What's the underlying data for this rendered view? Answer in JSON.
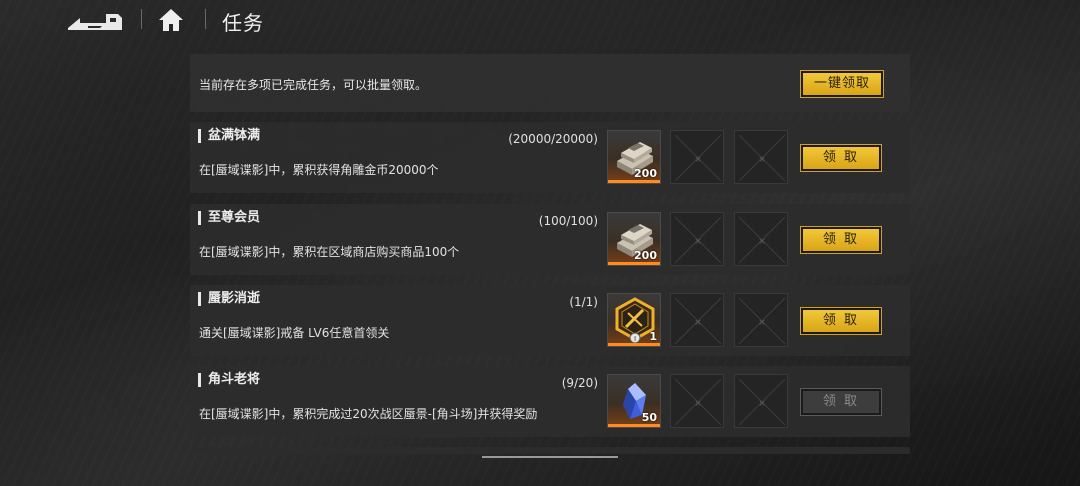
{
  "header": {
    "title": "任务",
    "back_icon": "back-arrow-icon",
    "home_icon": "home-icon"
  },
  "batch": {
    "text": "当前存在多项已完成任务，可以批量领取。",
    "button_label": "一键领取"
  },
  "tasks": [
    {
      "title": "盆满钵满",
      "progress": "(20000/20000)",
      "desc": "在[蜃域谍影]中，累积获得角雕金币20000个",
      "reward_icon": "coin-stack-icon",
      "reward_count": "200",
      "claim_label": "领 取",
      "claimable": true
    },
    {
      "title": "至尊会员",
      "progress": "(100/100)",
      "desc": "在[蜃域谍影]中，累积在区域商店购买商品100个",
      "reward_icon": "coin-stack-icon",
      "reward_count": "200",
      "claim_label": "领 取",
      "claimable": true
    },
    {
      "title": "蜃影消逝",
      "progress": "(1/1)",
      "desc": "通关[蜃域谍影]戒备 LV6任意首领关",
      "reward_icon": "medal-badge-icon",
      "reward_count": "1",
      "claim_label": "领 取",
      "claimable": true
    },
    {
      "title": "角斗老将",
      "progress": "(9/20)",
      "desc": "在[蜃域谍影]中，累积完成过20次战区蜃景-[角斗场]并获得奖励",
      "reward_icon": "blue-crystal-icon",
      "reward_count": "50",
      "claim_label": "领 取",
      "claimable": false
    }
  ],
  "colors": {
    "accent_gold": "#f3c73a",
    "reward_orange": "#ff8a1e"
  }
}
